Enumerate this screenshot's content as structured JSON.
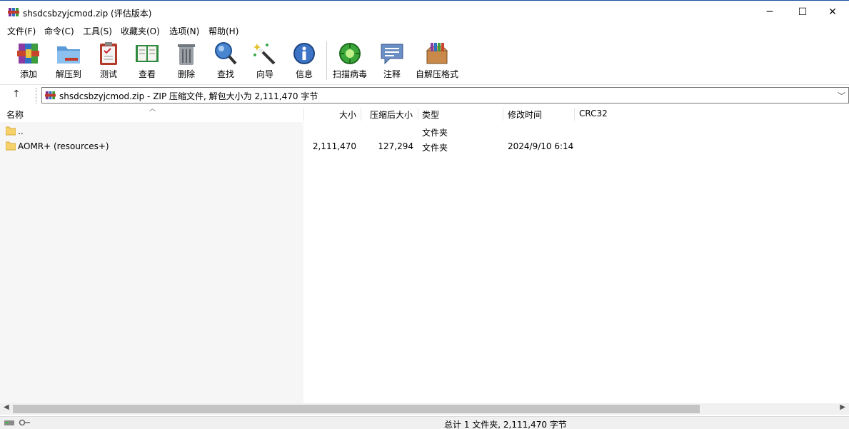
{
  "window": {
    "title": "shsdcsbzyjcmod.zip (评估版本)",
    "minimize_glyph": "─",
    "maximize_glyph": "☐",
    "close_glyph": "✕"
  },
  "menu": [
    "文件(F)",
    "命令(C)",
    "工具(S)",
    "收藏夹(O)",
    "选项(N)",
    "帮助(H)"
  ],
  "toolbar": {
    "add": "添加",
    "extract": "解压到",
    "test": "测试",
    "view": "查看",
    "delete": "删除",
    "find": "查找",
    "wizard": "向导",
    "info": "信息",
    "virus": "扫描病毒",
    "comment": "注释",
    "sfx": "自解压格式"
  },
  "address": {
    "up_glyph": "↑",
    "path": "shsdcsbzyjcmod.zip - ZIP 压缩文件, 解包大小为 2,111,470 字节",
    "dropdown_glyph": "﹀"
  },
  "columns": {
    "name": "名称",
    "size": "大小",
    "packed": "压缩后大小",
    "type": "类型",
    "modified": "修改时间",
    "crc": "CRC32"
  },
  "rows": [
    {
      "name": "..",
      "size": "",
      "packed": "",
      "type": "文件夹",
      "modified": ""
    },
    {
      "name": "AOMR+ (resources+)",
      "size": "2,111,470",
      "packed": "127,294",
      "type": "文件夹",
      "modified": "2024/9/10 6:14"
    }
  ],
  "status": {
    "summary": "总计 1 文件夹, 2,111,470 字节"
  },
  "colors": {
    "accent": "#1a4fa0",
    "folder": "#f7d26b",
    "scroll_thumb": "#c4c4c4"
  }
}
